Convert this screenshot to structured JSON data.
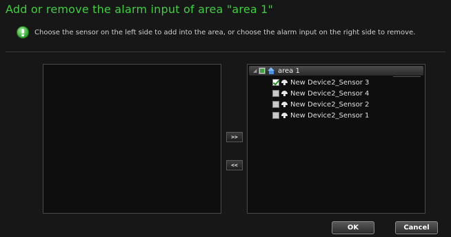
{
  "dialog": {
    "title": "Add or remove the alarm input of area \"area 1\"",
    "hint": "Choose the sensor on the left side to add into the area, or choose the alarm input on the right side to remove."
  },
  "left_pane": {
    "items": []
  },
  "right_pane": {
    "root": {
      "label": "area 1",
      "checkbox_state": "partial"
    },
    "items": [
      {
        "label": "New Device2_Sensor 3",
        "checked": true
      },
      {
        "label": "New Device2_Sensor 4",
        "checked": false
      },
      {
        "label": "New Device2_Sensor 2",
        "checked": false
      },
      {
        "label": "New Device2_Sensor 1",
        "checked": false
      }
    ]
  },
  "transfer": {
    "add_label": ">>",
    "remove_label": "<<"
  },
  "buttons": {
    "ok_label": "OK",
    "cancel_label": "Cancel"
  },
  "colors": {
    "title_green": "#3fcf3f",
    "background": "#171717",
    "check_green": "#1b8f1b"
  },
  "icons": {
    "hint": "info-bulb-icon",
    "root": "home-icon",
    "item": "sensor-icon",
    "expander": "expand-arrow-icon"
  }
}
